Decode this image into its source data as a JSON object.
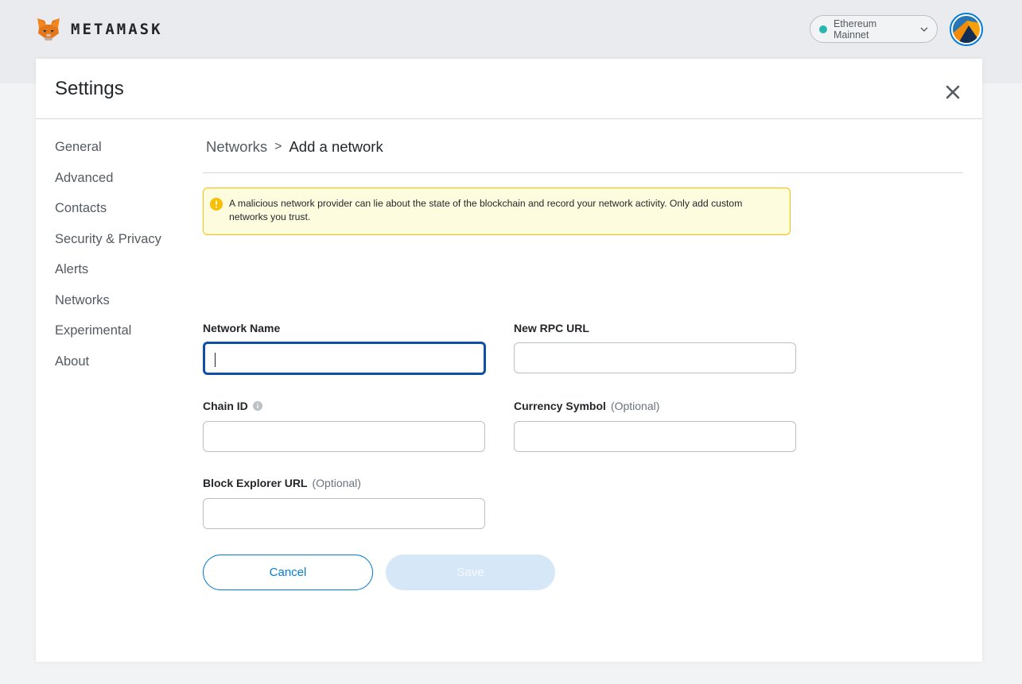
{
  "header": {
    "brand": "METAMASK",
    "network": "Ethereum Mainnet",
    "network_status_color": "#29b6af"
  },
  "settings": {
    "title": "Settings",
    "close_icon": "close-icon"
  },
  "sidebar": {
    "items": [
      {
        "label": "General"
      },
      {
        "label": "Advanced"
      },
      {
        "label": "Contacts"
      },
      {
        "label": "Security & Privacy"
      },
      {
        "label": "Alerts"
      },
      {
        "label": "Networks"
      },
      {
        "label": "Experimental"
      },
      {
        "label": "About"
      }
    ]
  },
  "breadcrumb": {
    "root": "Networks",
    "separator": ">",
    "current": "Add a network"
  },
  "warning": {
    "text": "A malicious network provider can lie about the state of the blockchain and record your network activity. Only add custom networks you trust.",
    "icon": "info-warning-icon",
    "color": "#f8c000"
  },
  "form": {
    "network_name": {
      "label": "Network Name",
      "value": ""
    },
    "rpc_url": {
      "label": "New RPC URL",
      "value": ""
    },
    "chain_id": {
      "label": "Chain ID",
      "value": ""
    },
    "currency_symbol": {
      "label": "Currency Symbol",
      "optional": "(Optional)",
      "value": ""
    },
    "block_explorer": {
      "label": "Block Explorer URL",
      "optional": "(Optional)",
      "value": ""
    }
  },
  "actions": {
    "cancel": "Cancel",
    "save": "Save",
    "accent_color": "#037dd6"
  }
}
